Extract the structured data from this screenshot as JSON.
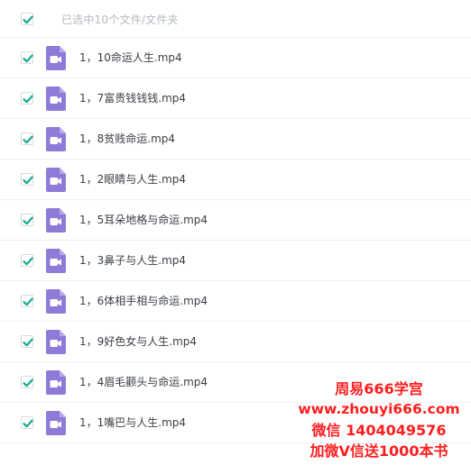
{
  "header": {
    "selection_label": "已选中10个文件/文件夹",
    "select_all_checked": true
  },
  "files": [
    {
      "name": "1，10命运人生.mp4",
      "checked": true,
      "icon": "video-file-icon"
    },
    {
      "name": "1，7富贵钱钱钱.mp4",
      "checked": true,
      "icon": "video-file-icon"
    },
    {
      "name": "1，8贫贱命运.mp4",
      "checked": true,
      "icon": "video-file-icon"
    },
    {
      "name": "1，2眼睛与人生.mp4",
      "checked": true,
      "icon": "video-file-icon"
    },
    {
      "name": "1，5耳朵地格与命运.mp4",
      "checked": true,
      "icon": "video-file-icon"
    },
    {
      "name": "1，3鼻子与人生.mp4",
      "checked": true,
      "icon": "video-file-icon"
    },
    {
      "name": "1，6体相手相与命运.mp4",
      "checked": true,
      "icon": "video-file-icon"
    },
    {
      "name": "1，9好色女与人生.mp4",
      "checked": true,
      "icon": "video-file-icon"
    },
    {
      "name": "1，4眉毛颧头与命运.mp4",
      "checked": true,
      "icon": "video-file-icon"
    },
    {
      "name": "1，1嘴巴与人生.mp4",
      "checked": true,
      "icon": "video-file-icon"
    }
  ],
  "watermark": {
    "line1": "周易666学宫",
    "line2": "www.zhouyi666.com",
    "line3": "微信 1404049576",
    "line4": "加微V信送1000本书"
  },
  "colors": {
    "check": "#1aa891",
    "file_icon": "#8f7ad8",
    "watermark": "#ff1e1e"
  }
}
